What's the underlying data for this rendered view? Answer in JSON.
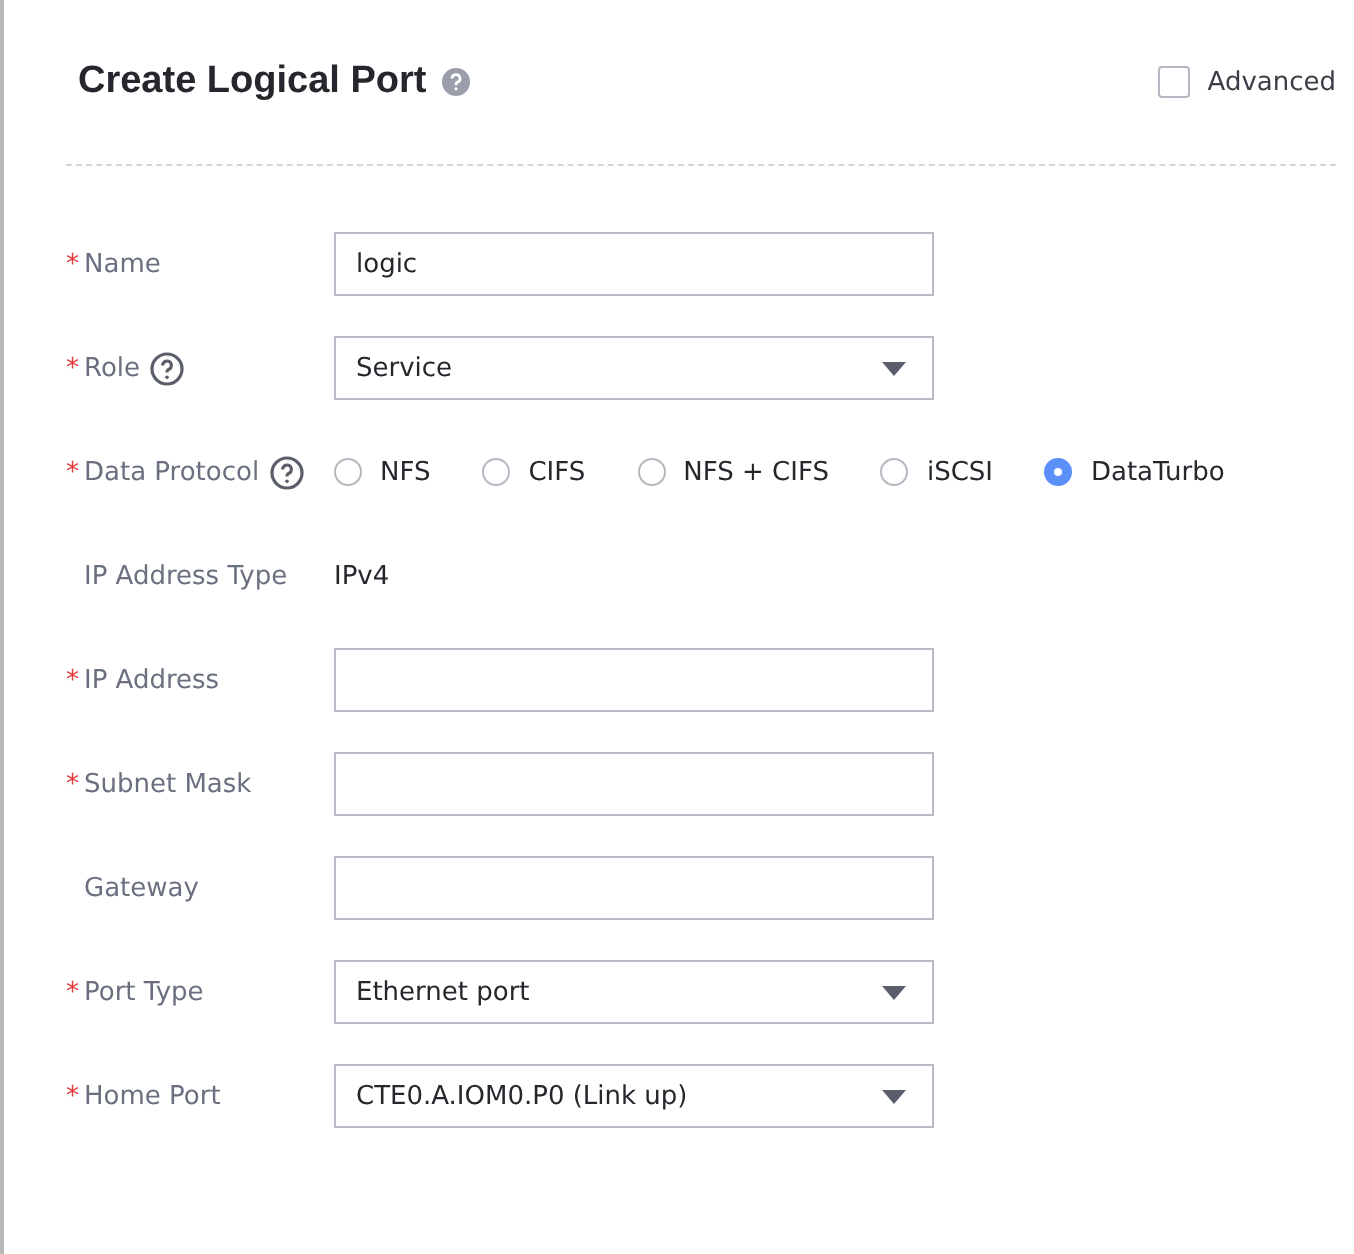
{
  "header": {
    "title": "Create Logical Port",
    "help": true,
    "advanced": {
      "label": "Advanced",
      "checked": false
    }
  },
  "fields": [
    {
      "kind": "input",
      "required_mark": "*",
      "label": "Name",
      "help": false,
      "value": "logic"
    },
    {
      "kind": "select",
      "required_mark": "*",
      "label": "Role",
      "help": true,
      "value": "Service"
    },
    {
      "kind": "radio",
      "required_mark": "*",
      "label": "Data Protocol",
      "help": true,
      "options": [
        {
          "label": "NFS",
          "selected": false
        },
        {
          "label": "CIFS",
          "selected": false
        },
        {
          "label": "NFS + CIFS",
          "selected": false
        },
        {
          "label": "iSCSI",
          "selected": false
        },
        {
          "label": "DataTurbo",
          "selected": true
        }
      ]
    },
    {
      "kind": "text",
      "label": "IP Address Type",
      "help": false,
      "value": "IPv4"
    },
    {
      "kind": "input",
      "required_mark": "*",
      "label": "IP Address",
      "help": false
    },
    {
      "kind": "input",
      "required_mark": "*",
      "label": "Subnet Mask",
      "help": false
    },
    {
      "kind": "input",
      "label": "Gateway",
      "help": false
    },
    {
      "kind": "select",
      "required_mark": "*",
      "label": "Port Type",
      "help": false,
      "value": "Ethernet port"
    },
    {
      "kind": "select",
      "required_mark": "*",
      "label": "Home Port",
      "help": false,
      "value": "CTE0.A.IOM0.P0 (Link up)"
    }
  ]
}
